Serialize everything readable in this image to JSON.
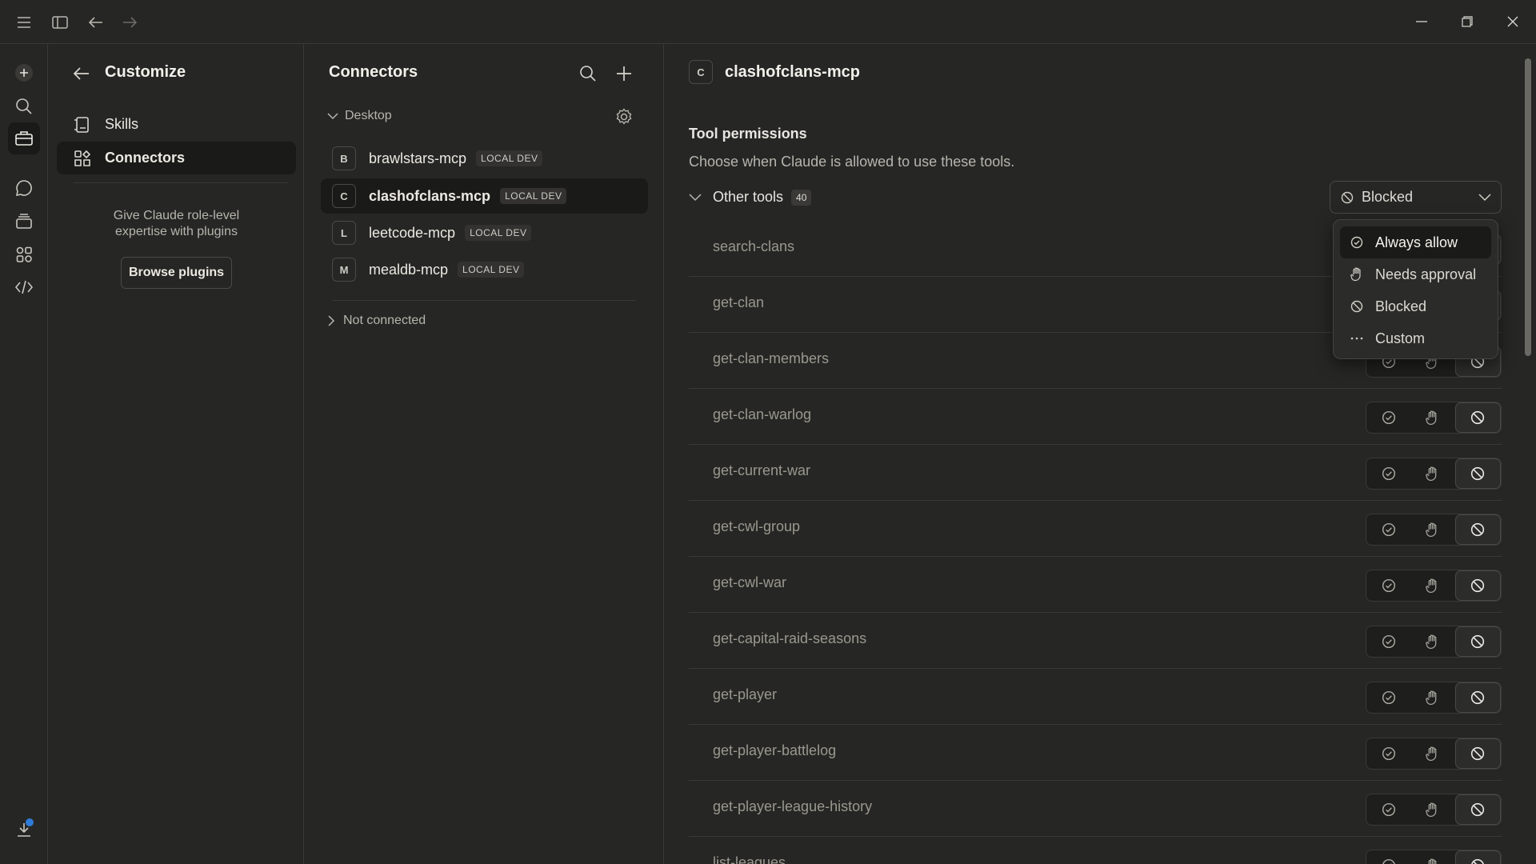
{
  "customize": {
    "title": "Customize",
    "nav": [
      {
        "label": "Skills",
        "icon": "skills-icon"
      },
      {
        "label": "Connectors",
        "icon": "connectors-icon"
      }
    ],
    "promo_text_1": "Give Claude role-level",
    "promo_text_2": "expertise with plugins",
    "browse_button": "Browse plugins"
  },
  "connectors": {
    "title": "Connectors",
    "group_desktop": "Desktop",
    "group_not_connected": "Not connected",
    "items": [
      {
        "letter": "B",
        "name": "brawlstars-mcp",
        "tag": "LOCAL DEV"
      },
      {
        "letter": "C",
        "name": "clashofclans-mcp",
        "tag": "LOCAL DEV"
      },
      {
        "letter": "L",
        "name": "leetcode-mcp",
        "tag": "LOCAL DEV"
      },
      {
        "letter": "M",
        "name": "mealdb-mcp",
        "tag": "LOCAL DEV"
      }
    ]
  },
  "detail": {
    "letter": "C",
    "title": "clashofclans-mcp",
    "perm_heading": "Tool permissions",
    "perm_desc": "Choose when Claude is allowed to use these tools.",
    "group_label": "Other tools",
    "group_count": "40",
    "dropdown_value": "Blocked",
    "menu": [
      "Always allow",
      "Needs approval",
      "Blocked",
      "Custom"
    ],
    "tools": [
      "search-clans",
      "get-clan",
      "get-clan-members",
      "get-clan-warlog",
      "get-current-war",
      "get-cwl-group",
      "get-cwl-war",
      "get-capital-raid-seasons",
      "get-player",
      "get-player-battlelog",
      "get-player-league-history",
      "list-leagues"
    ]
  }
}
